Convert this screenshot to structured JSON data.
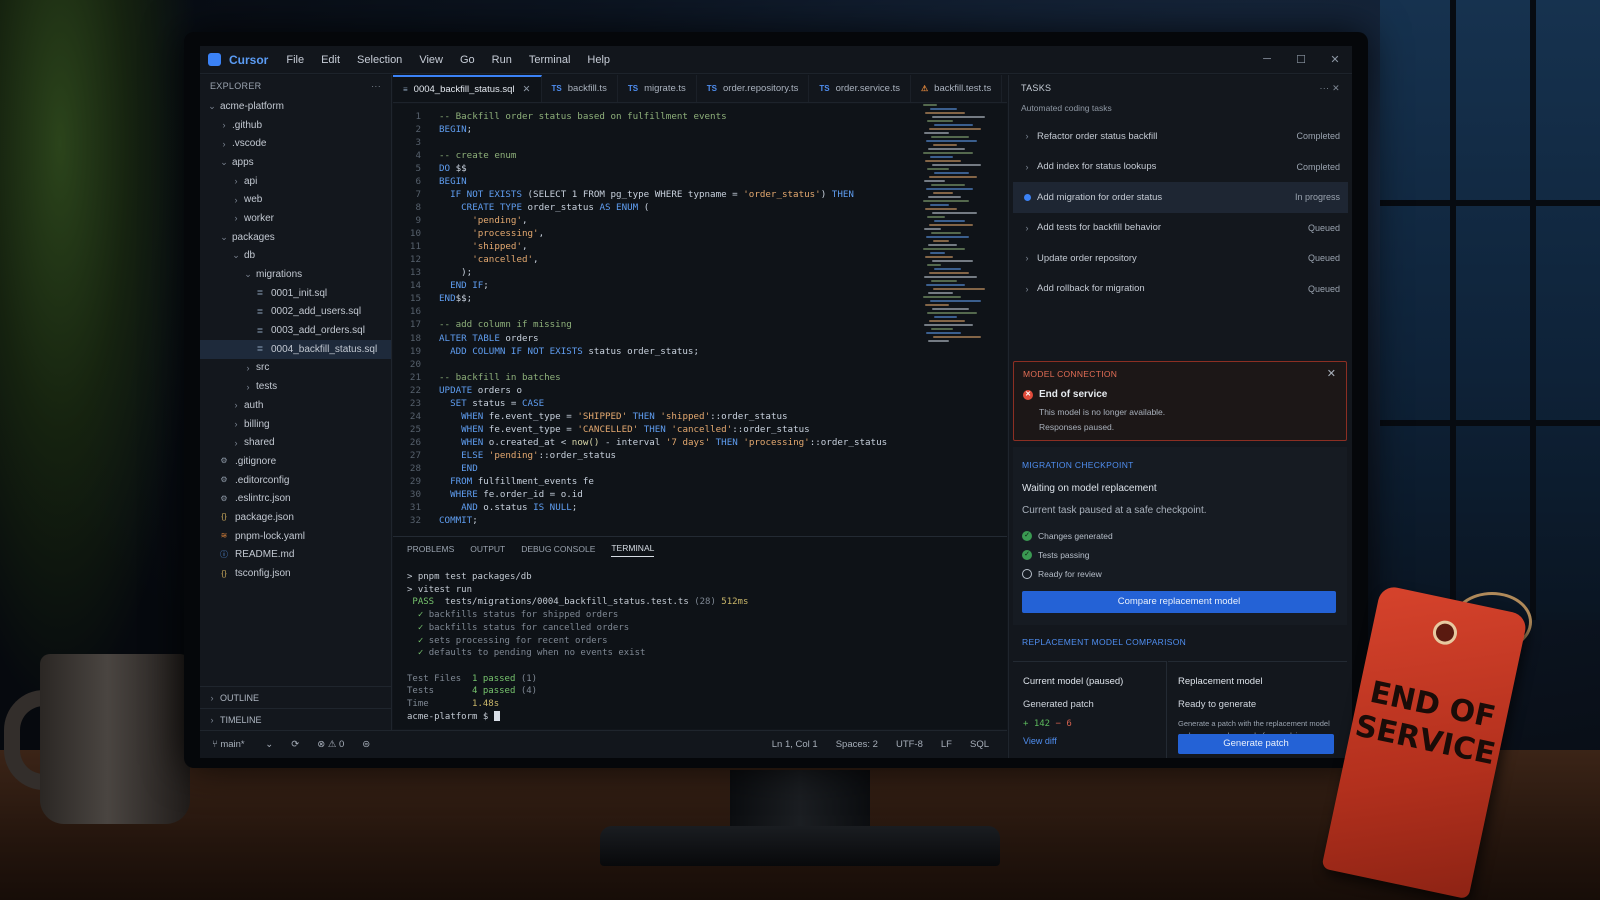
{
  "app": {
    "name": "Cursor",
    "brand_color": "#3b82f6"
  },
  "menu": [
    "File",
    "Edit",
    "Selection",
    "View",
    "Go",
    "Run",
    "Terminal",
    "Help"
  ],
  "window_controls": [
    "─",
    "☐",
    "✕"
  ],
  "explorer": {
    "title": "EXPLORER",
    "more": "···",
    "tree": [
      {
        "label": "acme-platform",
        "depth": 0,
        "kind": "folder-open"
      },
      {
        "label": ".github",
        "depth": 1,
        "kind": "folder"
      },
      {
        "label": ".vscode",
        "depth": 1,
        "kind": "folder"
      },
      {
        "label": "apps",
        "depth": 1,
        "kind": "folder-open"
      },
      {
        "label": "api",
        "depth": 2,
        "kind": "folder"
      },
      {
        "label": "web",
        "depth": 2,
        "kind": "folder"
      },
      {
        "label": "worker",
        "depth": 2,
        "kind": "folder"
      },
      {
        "label": "packages",
        "depth": 1,
        "kind": "folder-open"
      },
      {
        "label": "db",
        "depth": 2,
        "kind": "folder-open"
      },
      {
        "label": "migrations",
        "depth": 3,
        "kind": "folder-open"
      },
      {
        "label": "0001_init.sql",
        "depth": 4,
        "kind": "sql"
      },
      {
        "label": "0002_add_users.sql",
        "depth": 4,
        "kind": "sql"
      },
      {
        "label": "0003_add_orders.sql",
        "depth": 4,
        "kind": "sql"
      },
      {
        "label": "0004_backfill_status.sql",
        "depth": 4,
        "kind": "sql",
        "selected": true
      },
      {
        "label": "src",
        "depth": 3,
        "kind": "folder"
      },
      {
        "label": "tests",
        "depth": 3,
        "kind": "folder"
      },
      {
        "label": "auth",
        "depth": 2,
        "kind": "folder"
      },
      {
        "label": "billing",
        "depth": 2,
        "kind": "folder"
      },
      {
        "label": "shared",
        "depth": 2,
        "kind": "folder"
      },
      {
        "label": ".gitignore",
        "depth": 1,
        "kind": "config"
      },
      {
        "label": ".editorconfig",
        "depth": 1,
        "kind": "config"
      },
      {
        "label": ".eslintrc.json",
        "depth": 1,
        "kind": "config"
      },
      {
        "label": "package.json",
        "depth": 1,
        "kind": "json"
      },
      {
        "label": "pnpm-lock.yaml",
        "depth": 1,
        "kind": "yaml"
      },
      {
        "label": "README.md",
        "depth": 1,
        "kind": "md"
      },
      {
        "label": "tsconfig.json",
        "depth": 1,
        "kind": "json"
      }
    ],
    "outline_label": "OUTLINE",
    "timeline_label": "TIMELINE"
  },
  "tabs": [
    {
      "label": "0004_backfill_status.sql",
      "prefix": "≡",
      "active": true,
      "close": "✕"
    },
    {
      "label": "backfill.ts",
      "prefix": "TS"
    },
    {
      "label": "migrate.ts",
      "prefix": "TS"
    },
    {
      "label": "order.repository.ts",
      "prefix": "TS"
    },
    {
      "label": "order.service.ts",
      "prefix": "TS"
    },
    {
      "label": "backfill.test.ts",
      "prefix": "⚠"
    }
  ],
  "code": [
    {
      "n": "1",
      "segs": [
        [
          "c-com",
          "-- Backfill order status based on fulfillment events"
        ]
      ]
    },
    {
      "n": "2",
      "segs": [
        [
          "c-kw",
          "BEGIN"
        ],
        [
          "c-id",
          ";"
        ]
      ]
    },
    {
      "n": "3",
      "segs": []
    },
    {
      "n": "4",
      "segs": [
        [
          "c-com",
          "-- create enum"
        ]
      ]
    },
    {
      "n": "5",
      "segs": [
        [
          "c-kw",
          "DO"
        ],
        [
          "c-id",
          " $$"
        ]
      ]
    },
    {
      "n": "6",
      "segs": [
        [
          "c-kw",
          "BEGIN"
        ]
      ]
    },
    {
      "n": "7",
      "segs": [
        [
          "c-kw",
          "  IF NOT EXISTS"
        ],
        [
          "c-id",
          " (SELECT 1 FROM pg_type WHERE typname = "
        ],
        [
          "c-str",
          "'order_status'"
        ],
        [
          "c-id",
          ") "
        ],
        [
          "c-kw",
          "THEN"
        ]
      ]
    },
    {
      "n": "8",
      "segs": [
        [
          "c-kw",
          "    CREATE TYPE"
        ],
        [
          "c-id",
          " order_status "
        ],
        [
          "c-kw",
          "AS ENUM"
        ],
        [
          "c-id",
          " ("
        ]
      ]
    },
    {
      "n": "9",
      "segs": [
        [
          "c-str",
          "      'pending'"
        ],
        [
          "c-id",
          ","
        ]
      ]
    },
    {
      "n": "10",
      "segs": [
        [
          "c-str",
          "      'processing'"
        ],
        [
          "c-id",
          ","
        ]
      ]
    },
    {
      "n": "11",
      "segs": [
        [
          "c-str",
          "      'shipped'"
        ],
        [
          "c-id",
          ","
        ]
      ]
    },
    {
      "n": "12",
      "segs": [
        [
          "c-str",
          "      'cancelled'"
        ],
        [
          "c-id",
          ","
        ]
      ]
    },
    {
      "n": "13",
      "segs": [
        [
          "c-id",
          "    );"
        ]
      ]
    },
    {
      "n": "14",
      "segs": [
        [
          "c-kw",
          "  END IF"
        ],
        [
          "c-id",
          ";"
        ]
      ]
    },
    {
      "n": "15",
      "segs": [
        [
          "c-kw",
          "END"
        ],
        [
          "c-id",
          "$$;"
        ]
      ]
    },
    {
      "n": "16",
      "segs": []
    },
    {
      "n": "17",
      "segs": [
        [
          "c-com",
          "-- add column if missing"
        ]
      ]
    },
    {
      "n": "18",
      "segs": [
        [
          "c-kw",
          "ALTER TABLE"
        ],
        [
          "c-id",
          " orders"
        ]
      ]
    },
    {
      "n": "19",
      "segs": [
        [
          "c-kw",
          "  ADD COLUMN IF NOT EXISTS"
        ],
        [
          "c-id",
          " status order_status;"
        ]
      ]
    },
    {
      "n": "20",
      "segs": []
    },
    {
      "n": "21",
      "segs": [
        [
          "c-com",
          "-- backfill in batches"
        ]
      ]
    },
    {
      "n": "22",
      "segs": [
        [
          "c-kw",
          "UPDATE"
        ],
        [
          "c-id",
          " orders o"
        ]
      ]
    },
    {
      "n": "23",
      "segs": [
        [
          "c-kw",
          "  SET"
        ],
        [
          "c-id",
          " status = "
        ],
        [
          "c-kw",
          "CASE"
        ]
      ]
    },
    {
      "n": "24",
      "segs": [
        [
          "c-kw",
          "    WHEN"
        ],
        [
          "c-id",
          " fe.event_type = "
        ],
        [
          "c-str",
          "'SHIPPED'"
        ],
        [
          "c-kw",
          " THEN "
        ],
        [
          "c-str",
          "'shipped'"
        ],
        [
          "c-id",
          "::order_status"
        ]
      ]
    },
    {
      "n": "25",
      "segs": [
        [
          "c-kw",
          "    WHEN"
        ],
        [
          "c-id",
          " fe.event_type = "
        ],
        [
          "c-str",
          "'CANCELLED'"
        ],
        [
          "c-kw",
          " THEN "
        ],
        [
          "c-str",
          "'cancelled'"
        ],
        [
          "c-id",
          "::order_status"
        ]
      ]
    },
    {
      "n": "26",
      "segs": [
        [
          "c-kw",
          "    WHEN"
        ],
        [
          "c-id",
          " o.created_at < "
        ],
        [
          "c-fn",
          "now()"
        ],
        [
          "c-id",
          " - interval "
        ],
        [
          "c-str",
          "'7 days'"
        ],
        [
          "c-kw",
          " THEN "
        ],
        [
          "c-str",
          "'processing'"
        ],
        [
          "c-id",
          "::order_status"
        ]
      ]
    },
    {
      "n": "27",
      "segs": [
        [
          "c-kw",
          "    ELSE"
        ],
        [
          "c-str",
          " 'pending'"
        ],
        [
          "c-id",
          "::order_status"
        ]
      ]
    },
    {
      "n": "28",
      "segs": [
        [
          "c-kw",
          "    END"
        ]
      ]
    },
    {
      "n": "29",
      "segs": [
        [
          "c-kw",
          "  FROM"
        ],
        [
          "c-id",
          " fulfillment_events fe"
        ]
      ]
    },
    {
      "n": "30",
      "segs": [
        [
          "c-kw",
          "  WHERE"
        ],
        [
          "c-id",
          " fe.order_id = o.id"
        ]
      ]
    },
    {
      "n": "31",
      "segs": [
        [
          "c-kw",
          "    AND"
        ],
        [
          "c-id",
          " o.status "
        ],
        [
          "c-kw",
          "IS NULL"
        ],
        [
          "c-id",
          ";"
        ]
      ]
    },
    {
      "n": "32",
      "segs": [
        [
          "c-kw",
          "COMMIT"
        ],
        [
          "c-id",
          ";"
        ]
      ]
    }
  ],
  "panel": {
    "tabs": [
      "PROBLEMS",
      "OUTPUT",
      "DEBUG CONSOLE",
      "TERMINAL"
    ],
    "active_tab": "TERMINAL",
    "lines": [
      [
        [
          "",
          "> pnpm test packages/db"
        ]
      ],
      [
        [
          "",
          "> vitest run"
        ]
      ],
      [
        [
          "t-pass",
          " PASS "
        ],
        [
          "",
          " tests/migrations/0004_backfill_status.test.ts "
        ],
        [
          "t-dim",
          "(28) "
        ],
        [
          "t-num",
          "512ms"
        ]
      ],
      [
        [
          "t-pass",
          "  ✓ "
        ],
        [
          "t-dim",
          "backfills status for shipped orders"
        ]
      ],
      [
        [
          "t-pass",
          "  ✓ "
        ],
        [
          "t-dim",
          "backfills status for cancelled orders"
        ]
      ],
      [
        [
          "t-pass",
          "  ✓ "
        ],
        [
          "t-dim",
          "sets processing for recent orders"
        ]
      ],
      [
        [
          "t-pass",
          "  ✓ "
        ],
        [
          "t-dim",
          "defaults to pending when no events exist"
        ]
      ],
      [],
      [
        [
          "t-dim",
          "Test Files  "
        ],
        [
          "t-pass",
          "1 passed "
        ],
        [
          "t-dim",
          "(1)"
        ]
      ],
      [
        [
          "t-dim",
          "Tests       "
        ],
        [
          "t-pass",
          "4 passed "
        ],
        [
          "t-dim",
          "(4)"
        ]
      ],
      [
        [
          "t-dim",
          "Time        "
        ],
        [
          "t-num",
          "1.48s"
        ]
      ],
      [
        [
          "",
          "acme-platform $ "
        ]
      ]
    ]
  },
  "statusbar": {
    "branch": "main*",
    "sync": "⟳",
    "problems": "⊗ ⚠ 0",
    "bell": "⊜",
    "position": "Ln 1, Col 1",
    "spaces": "Spaces: 2",
    "encoding": "UTF-8",
    "eol": "LF",
    "language": "SQL"
  },
  "tasks": {
    "title": "TASKS",
    "actions": "···   ✕",
    "subtitle": "Automated coding tasks",
    "items": [
      {
        "label": "Refactor order status backfill",
        "status": "Completed"
      },
      {
        "label": "Add index for status lookups",
        "status": "Completed"
      },
      {
        "label": "Add migration for order status",
        "status": "In progress",
        "active": true
      },
      {
        "label": "Add tests for backfill behavior",
        "status": "Queued"
      },
      {
        "label": "Update order repository",
        "status": "Queued"
      },
      {
        "label": "Add rollback for migration",
        "status": "Queued"
      }
    ],
    "model_connection": {
      "title": "MODEL CONNECTION",
      "close": "✕",
      "heading": "End of service",
      "line1": "This model is no longer available.",
      "line2": "Responses paused.",
      "error_color": "#e14b3b"
    },
    "checkpoint": {
      "title": "MIGRATION CHECKPOINT",
      "heading": "Waiting on model replacement",
      "description": "Current task paused at a safe checkpoint.",
      "checks": [
        {
          "label": "Changes generated",
          "done": true
        },
        {
          "label": "Tests passing",
          "done": true
        },
        {
          "label": "Ready for review",
          "done": false
        }
      ],
      "button": "Compare replacement model"
    },
    "comparison": {
      "title": "REPLACEMENT MODEL COMPARISON",
      "current_heading": "Current model (paused)",
      "current_sub": "Generated patch",
      "diff_plus": "+ 142",
      "diff_minus": "− 6",
      "view_diff": "View diff",
      "replacement_heading": "Replacement model",
      "replacement_sub": "Ready to generate",
      "replacement_desc": "Generate a patch with the replacement model and compare changes before applying.",
      "button": "Generate patch"
    }
  },
  "tag": {
    "text": "END OF SERVICE",
    "color": "#c93a24"
  }
}
